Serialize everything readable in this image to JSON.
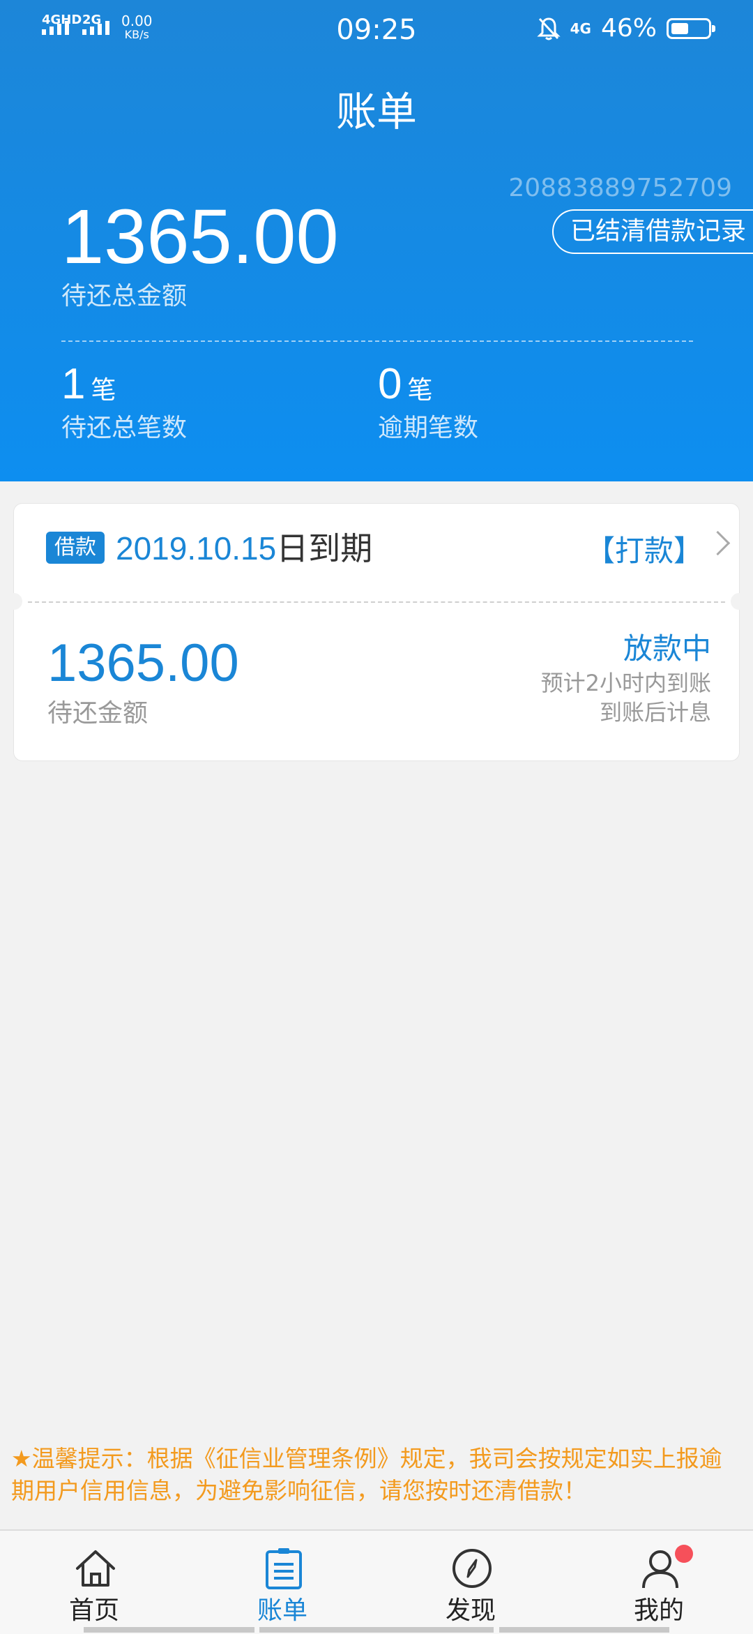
{
  "status_bar": {
    "network1": "4GHD",
    "network2": "2G",
    "speed_value": "0.00",
    "speed_unit": "KB/s",
    "time": "09:25",
    "network3": "4G",
    "battery": "46%"
  },
  "header": {
    "title": "账单",
    "account_number": "20883889752709",
    "records_button": "已结清借款记录",
    "total_amount": "1365.00",
    "total_label": "待还总金额",
    "count_value": "1",
    "count_unit": "笔",
    "count_label": "待还总笔数",
    "overdue_value": "0",
    "overdue_unit": "笔",
    "overdue_label": "逾期笔数"
  },
  "loan_card": {
    "tag": "借款",
    "due_date": "2019.10.15",
    "due_suffix": "日到期",
    "action_link": "【打款】",
    "amount": "1365.00",
    "amount_label": "待还金额",
    "status": "放款中",
    "status_note1": "预计2小时内到账",
    "status_note2": "到账后计息"
  },
  "notice": "★温馨提示：根据《征信业管理条例》规定，我司会按规定如实上报逾期用户信用信息，为避免影响征信，请您按时还清借款！",
  "tabs": [
    {
      "label": "首页",
      "icon": "home-icon"
    },
    {
      "label": "账单",
      "icon": "bill-icon"
    },
    {
      "label": "发现",
      "icon": "compass-icon"
    },
    {
      "label": "我的",
      "icon": "user-icon"
    }
  ],
  "colors": {
    "brand_blue": "#1a86d6",
    "header_blue": "#0d8ef0",
    "notice_orange": "#f39a1e",
    "badge_red": "#f6505a"
  }
}
